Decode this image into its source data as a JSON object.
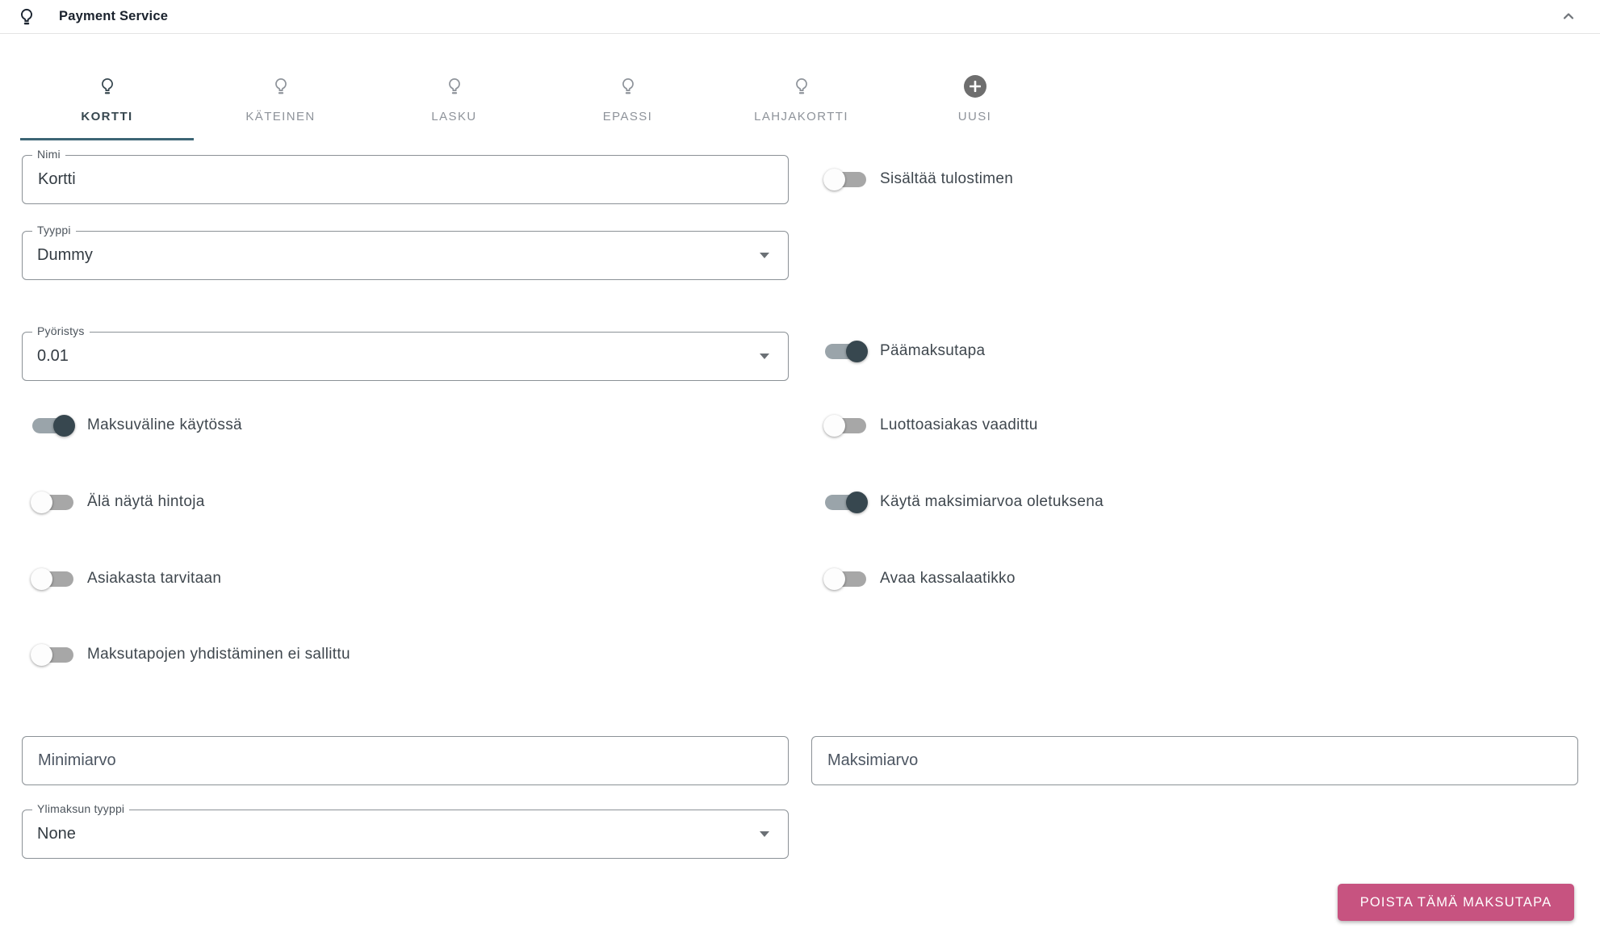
{
  "header": {
    "title": "Payment Service",
    "icon": "lightbulb-icon",
    "collapse_icon": "chevron-up-icon"
  },
  "tabs": [
    {
      "label": "KORTTI",
      "icon": "lightbulb",
      "active": true
    },
    {
      "label": "KÄTEINEN",
      "icon": "lightbulb",
      "active": false
    },
    {
      "label": "LASKU",
      "icon": "lightbulb",
      "active": false
    },
    {
      "label": "EPASSI",
      "icon": "lightbulb",
      "active": false
    },
    {
      "label": "LAHJAKORTTI",
      "icon": "lightbulb",
      "active": false
    },
    {
      "label": "UUSI",
      "icon": "plus-circle",
      "active": false
    }
  ],
  "form": {
    "fields": {
      "nimi": {
        "label": "Nimi",
        "value": "Kortti"
      },
      "tyyppi": {
        "label": "Tyyppi",
        "value": "Dummy"
      },
      "pyoristys": {
        "label": "Pyöristys",
        "value": "0.01"
      },
      "minimiarvo": {
        "placeholder": "Minimiarvo",
        "value": ""
      },
      "maksimiarvo": {
        "placeholder": "Maksimiarvo",
        "value": ""
      },
      "ylimaksun_tyyppi": {
        "label": "Ylimaksun tyyppi",
        "value": "None"
      }
    },
    "toggles_left": [
      {
        "label": "Maksuväline käytössä",
        "on": true
      },
      {
        "label": "Älä näytä hintoja",
        "on": false
      },
      {
        "label": "Asiakasta tarvitaan",
        "on": false
      },
      {
        "label": "Maksutapojen yhdistäminen ei sallittu",
        "on": false
      }
    ],
    "toggles_right": [
      {
        "label": "Sisältää tulostimen",
        "on": false
      },
      {
        "label": "Päämaksutapa",
        "on": true
      },
      {
        "label": "Luottoasiakas vaadittu",
        "on": false
      },
      {
        "label": "Käytä maksimiarvoa oletuksena",
        "on": true
      },
      {
        "label": "Avaa kassalaatikko",
        "on": false
      }
    ]
  },
  "actions": {
    "delete_label": "POISTA TÄMÄ MAKSUTAPA"
  },
  "colors": {
    "accent_teal": "#3c6575",
    "dark_slate": "#37474f",
    "danger_pink": "#c75380",
    "inactive_gray": "#8e939a"
  }
}
